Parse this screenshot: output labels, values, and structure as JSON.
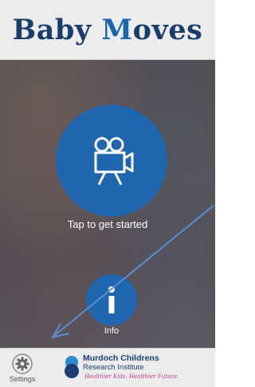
{
  "header": {
    "title_part1": "Baby ",
    "title_accent": "M",
    "title_part2": "oves"
  },
  "main": {
    "start_label": "Tap to get started",
    "start_icon": "video-camera-icon",
    "info_label": "Info",
    "info_icon": "info-icon"
  },
  "footer": {
    "settings_label": "Settings",
    "settings_icon": "gear-icon",
    "logo_line1": "Murdoch Childrens",
    "logo_line2": "Research Institute",
    "logo_tagline": "Healthier Kids. Healthier Future."
  },
  "colors": {
    "brand_dark": "#1a3e6c",
    "brand_blue": "#1c66b0",
    "button_blue": "#1f66ae",
    "tagline_pink": "#c23a8a"
  }
}
